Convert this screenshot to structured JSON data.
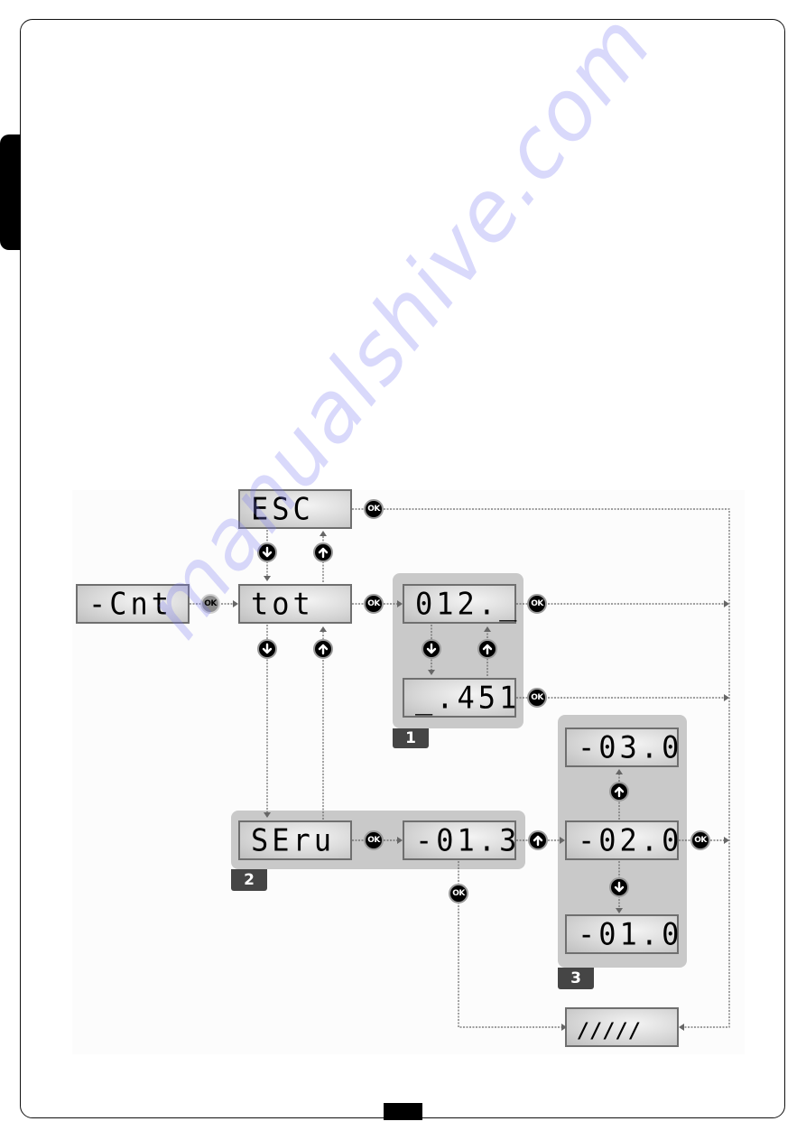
{
  "page": {
    "side_tab": "",
    "page_number": "",
    "watermark": "manualshive.com"
  },
  "buttons": {
    "ok_label": "OK",
    "up_icon": "arrow-up-icon",
    "down_icon": "arrow-down-icon"
  },
  "displays": {
    "cnt": "-Cnt",
    "esc": "ESC",
    "tot": "tot",
    "tot_high": "012._",
    "tot_low": "_.451",
    "serv": "SEru",
    "serv_value": "-01.3",
    "serv_up": "-03.0",
    "serv_current": "-02.0",
    "serv_down": "-01.0",
    "exit": "/////"
  },
  "groups": {
    "g1": "1",
    "g2": "2",
    "g3": "3"
  },
  "colors": {
    "lcd_border": "#6f6f6f",
    "group_panel": "#c9c9c9",
    "group_tag": "#454545",
    "connector": "#666666",
    "watermark": "#7878f0"
  }
}
